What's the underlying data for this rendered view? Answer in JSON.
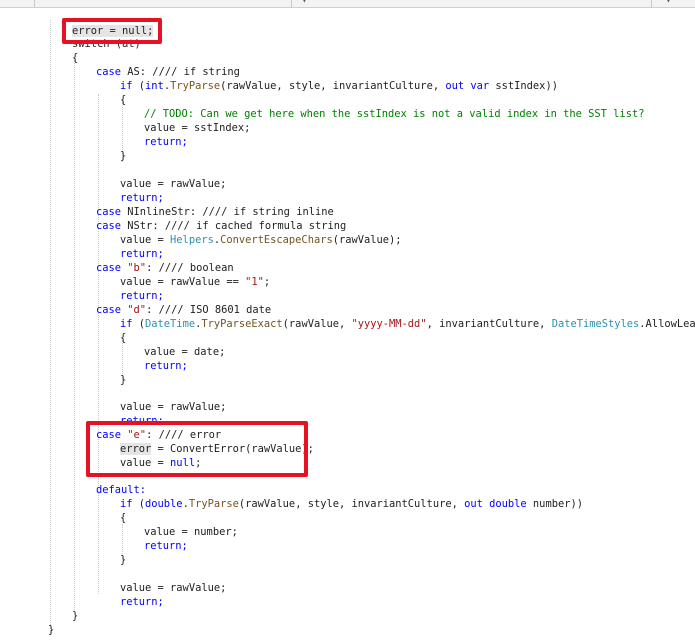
{
  "tabs": {
    "left_fragment": "{ ... }",
    "dropdown_icon": "chevron-down-icon"
  },
  "code": {
    "l0": "error = null;",
    "l1": "switch (at)",
    "l2": "{",
    "l3a": "case ",
    "l3b": "AS",
    "l3c": ": //// if string",
    "l4a": "if",
    "l4b": " (",
    "l4c": "int",
    "l4d": ".",
    "l4e": "TryParse",
    "l4f": "(rawValue, style, invariantCulture, ",
    "l4g": "out var",
    "l4h": " sstIndex))",
    "l5": "{",
    "l6": "// TODO: Can we get here when the sstIndex is not a valid index in the SST list?",
    "l7": "value = sstIndex;",
    "l8": "return;",
    "l9": "}",
    "l10": "value = rawValue;",
    "l11": "return;",
    "l12a": "case ",
    "l12b": "NInlineStr",
    "l12c": ": //// if string inline",
    "l13a": "case ",
    "l13b": "NStr",
    "l13c": ": //// if cached formula string",
    "l14a": "value = ",
    "l14b": "Helpers",
    "l14c": ".",
    "l14d": "ConvertEscapeChars",
    "l14e": "(rawValue);",
    "l15": "return;",
    "l16a": "case ",
    "l16b": "\"b\"",
    "l16c": ": //// boolean",
    "l17a": "value = rawValue == ",
    "l17b": "\"1\"",
    "l17c": ";",
    "l18": "return;",
    "l19a": "case ",
    "l19b": "\"d\"",
    "l19c": ": //// ISO 8601 date",
    "l20a": "if",
    "l20b": " (",
    "l20c": "DateTime",
    "l20d": ".",
    "l20e": "TryParseExact",
    "l20f": "(rawValue, ",
    "l20g": "\"yyyy-MM-dd\"",
    "l20h": ", invariantCulture, ",
    "l20i": "DateTimeStyles",
    "l20j": ".AllowLeadingWhi",
    "l21": "{",
    "l22": "value = date;",
    "l23": "return;",
    "l24": "}",
    "l25": "value = rawValue;",
    "l26": "return;",
    "l27a": "case ",
    "l27b": "\"e\"",
    "l27c": ": //// error",
    "l28a": "error",
    "l28b": " = ConvertError(rawValue);",
    "l29a": "value = ",
    "l29b": "null",
    "l29c": ";",
    "l30": "default:",
    "l31a": "if",
    "l31b": " (",
    "l31c": "double",
    "l31d": ".",
    "l31e": "TryParse",
    "l31f": "(rawValue, style, invariantCulture, ",
    "l31g": "out double",
    "l31h": " number))",
    "l32": "{",
    "l33": "value = number;",
    "l34": "return;",
    "l35": "}",
    "l36": "value = rawValue;",
    "l37": "return;",
    "l38": "}",
    "l39": "}"
  },
  "highlight_color": "#e81123"
}
